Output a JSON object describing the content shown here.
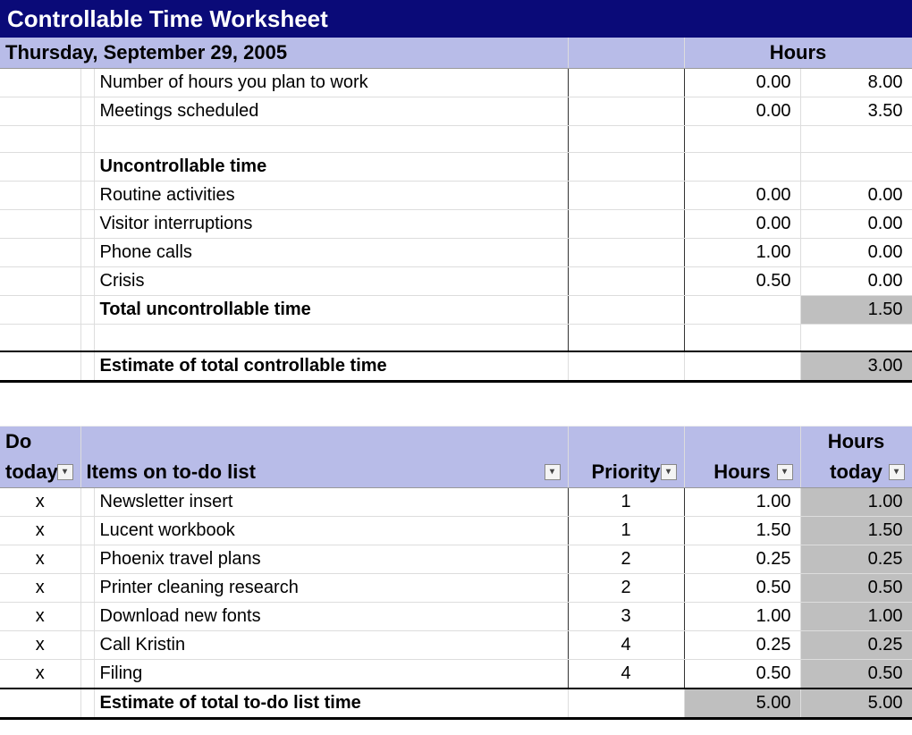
{
  "title": "Controllable Time Worksheet",
  "date_header": "Thursday, September 29, 2005",
  "hours_label": "Hours",
  "top_rows": [
    {
      "label": "Number of hours you plan to work",
      "v1": "0.00",
      "v2": "8.00"
    },
    {
      "label": "Meetings scheduled",
      "v1": "0.00",
      "v2": "3.50"
    }
  ],
  "uncontrollable_heading": "Uncontrollable time",
  "uncontrollable_rows": [
    {
      "label": "Routine activities",
      "v1": "0.00",
      "v2": "0.00"
    },
    {
      "label": "Visitor interruptions",
      "v1": "0.00",
      "v2": "0.00"
    },
    {
      "label": "Phone calls",
      "v1": "1.00",
      "v2": "0.00"
    },
    {
      "label": "Crisis",
      "v1": "0.50",
      "v2": "0.00"
    }
  ],
  "total_uncontrollable_label": "Total uncontrollable time",
  "total_uncontrollable_value": "1.50",
  "estimate_controllable_label": "Estimate of total controllable time",
  "estimate_controllable_value": "3.00",
  "todo_headers": {
    "do_today_line1": "Do",
    "do_today_line2": "today",
    "items": "Items on to-do list",
    "priority": "Priority",
    "hours": "Hours",
    "hours_today_line1": "Hours",
    "hours_today_line2": "today"
  },
  "todo_rows": [
    {
      "do": "x",
      "item": "Newsletter insert",
      "priority": "1",
      "hours": "1.00",
      "hours_today": "1.00"
    },
    {
      "do": "x",
      "item": "Lucent workbook",
      "priority": "1",
      "hours": "1.50",
      "hours_today": "1.50"
    },
    {
      "do": "x",
      "item": "Phoenix travel plans",
      "priority": "2",
      "hours": "0.25",
      "hours_today": "0.25"
    },
    {
      "do": "x",
      "item": "Printer cleaning research",
      "priority": "2",
      "hours": "0.50",
      "hours_today": "0.50"
    },
    {
      "do": "x",
      "item": "Download new fonts",
      "priority": "3",
      "hours": "1.00",
      "hours_today": "1.00"
    },
    {
      "do": "x",
      "item": "Call Kristin",
      "priority": "4",
      "hours": "0.25",
      "hours_today": "0.25"
    },
    {
      "do": "x",
      "item": "Filing",
      "priority": "4",
      "hours": "0.50",
      "hours_today": "0.50"
    }
  ],
  "estimate_todo_label": "Estimate of total to-do list time",
  "estimate_todo_hours": "5.00",
  "estimate_todo_hours_today": "5.00",
  "filter_glyph": "▾"
}
